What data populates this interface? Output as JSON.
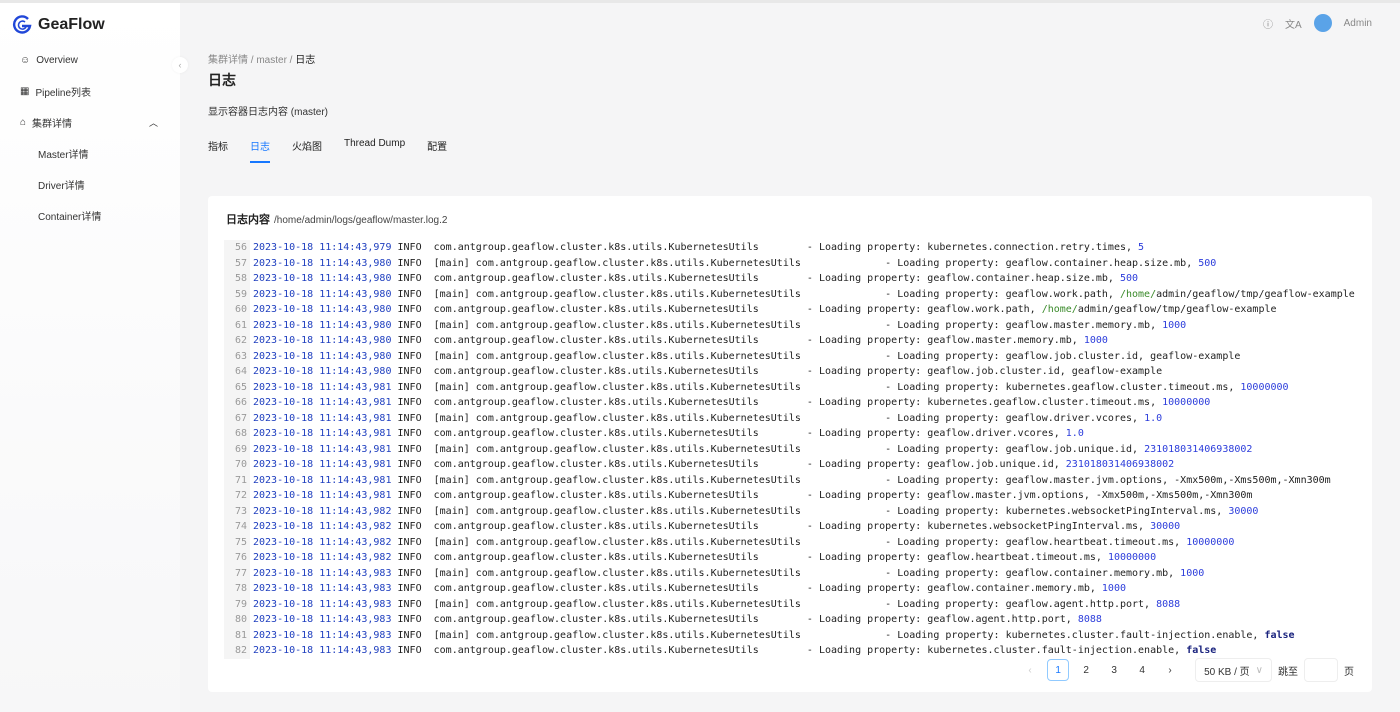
{
  "app": {
    "name": "GeaFlow",
    "user": "Admin"
  },
  "sidebar": {
    "items": [
      {
        "label": "Overview",
        "icon": "smile-icon"
      },
      {
        "label": "Pipeline列表",
        "icon": "table-icon"
      },
      {
        "label": "集群详情",
        "icon": "cluster-icon"
      }
    ],
    "sub": [
      "Master详情",
      "Driver详情",
      "Container详情"
    ]
  },
  "breadcrumb": [
    "集群详情",
    "master",
    "日志"
  ],
  "page": {
    "title": "日志",
    "description": "显示容器日志内容 (master)"
  },
  "tabs": [
    "指标",
    "日志",
    "火焰图",
    "Thread Dump",
    "配置"
  ],
  "active_tab": "日志",
  "log": {
    "title": "日志内容",
    "path": "/home/admin/logs/geaflow/master.log.2",
    "lines": [
      [
        56,
        "2023-10-18",
        "11:14:43,979",
        false,
        "kubernetes.connection.retry.times",
        "5",
        "num"
      ],
      [
        57,
        "2023-10-18",
        "11:14:43,980",
        true,
        "geaflow.container.heap.size.mb",
        "500",
        "num"
      ],
      [
        58,
        "2023-10-18",
        "11:14:43,980",
        false,
        "geaflow.container.heap.size.mb",
        "500",
        "num"
      ],
      [
        59,
        "2023-10-18",
        "11:14:43,980",
        true,
        "geaflow.work.path",
        "/home/admin/geaflow/tmp/geaflow-example",
        "path"
      ],
      [
        60,
        "2023-10-18",
        "11:14:43,980",
        false,
        "geaflow.work.path",
        "/home/admin/geaflow/tmp/geaflow-example",
        "path"
      ],
      [
        61,
        "2023-10-18",
        "11:14:43,980",
        true,
        "geaflow.master.memory.mb",
        "1000",
        "num"
      ],
      [
        62,
        "2023-10-18",
        "11:14:43,980",
        false,
        "geaflow.master.memory.mb",
        "1000",
        "num"
      ],
      [
        63,
        "2023-10-18",
        "11:14:43,980",
        true,
        "geaflow.job.cluster.id",
        "geaflow-example",
        "str"
      ],
      [
        64,
        "2023-10-18",
        "11:14:43,980",
        false,
        "geaflow.job.cluster.id",
        "geaflow-example",
        "str"
      ],
      [
        65,
        "2023-10-18",
        "11:14:43,981",
        true,
        "kubernetes.geaflow.cluster.timeout.ms",
        "10000000",
        "num"
      ],
      [
        66,
        "2023-10-18",
        "11:14:43,981",
        false,
        "kubernetes.geaflow.cluster.timeout.ms",
        "10000000",
        "num"
      ],
      [
        67,
        "2023-10-18",
        "11:14:43,981",
        true,
        "geaflow.driver.vcores",
        "1.0",
        "num"
      ],
      [
        68,
        "2023-10-18",
        "11:14:43,981",
        false,
        "geaflow.driver.vcores",
        "1.0",
        "num"
      ],
      [
        69,
        "2023-10-18",
        "11:14:43,981",
        true,
        "geaflow.job.unique.id",
        "231018031406938002",
        "num"
      ],
      [
        70,
        "2023-10-18",
        "11:14:43,981",
        false,
        "geaflow.job.unique.id",
        "231018031406938002",
        "num"
      ],
      [
        71,
        "2023-10-18",
        "11:14:43,981",
        true,
        "geaflow.master.jvm.options",
        "-Xmx500m,-Xms500m,-Xmn300m",
        "str"
      ],
      [
        72,
        "2023-10-18",
        "11:14:43,981",
        false,
        "geaflow.master.jvm.options",
        "-Xmx500m,-Xms500m,-Xmn300m",
        "str"
      ],
      [
        73,
        "2023-10-18",
        "11:14:43,982",
        true,
        "kubernetes.websocketPingInterval.ms",
        "30000",
        "num"
      ],
      [
        74,
        "2023-10-18",
        "11:14:43,982",
        false,
        "kubernetes.websocketPingInterval.ms",
        "30000",
        "num"
      ],
      [
        75,
        "2023-10-18",
        "11:14:43,982",
        true,
        "geaflow.heartbeat.timeout.ms",
        "10000000",
        "num"
      ],
      [
        76,
        "2023-10-18",
        "11:14:43,982",
        false,
        "geaflow.heartbeat.timeout.ms",
        "10000000",
        "num"
      ],
      [
        77,
        "2023-10-18",
        "11:14:43,983",
        true,
        "geaflow.container.memory.mb",
        "1000",
        "num"
      ],
      [
        78,
        "2023-10-18",
        "11:14:43,983",
        false,
        "geaflow.container.memory.mb",
        "1000",
        "num"
      ],
      [
        79,
        "2023-10-18",
        "11:14:43,983",
        true,
        "geaflow.agent.http.port",
        "8088",
        "num"
      ],
      [
        80,
        "2023-10-18",
        "11:14:43,983",
        false,
        "geaflow.agent.http.port",
        "8088",
        "num"
      ],
      [
        81,
        "2023-10-18",
        "11:14:43,983",
        true,
        "kubernetes.cluster.fault-injection.enable",
        "false",
        "bool"
      ],
      [
        82,
        "2023-10-18",
        "11:14:43,983",
        false,
        "kubernetes.cluster.fault-injection.enable",
        "false",
        "bool"
      ]
    ],
    "level": "INFO",
    "thread": "[main]",
    "logger": "com.antgroup.geaflow.cluster.k8s.utils.KubernetesUtils",
    "message_prefix": "- Loading property:"
  },
  "pagination": {
    "pages": [
      "1",
      "2",
      "3",
      "4"
    ],
    "current": "1",
    "page_size": "50 KB / 页",
    "jump_label": "跳至",
    "page_suffix": "页"
  }
}
